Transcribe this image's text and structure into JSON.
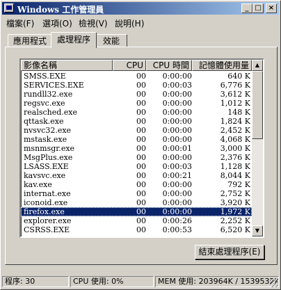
{
  "window": {
    "title": "Windows 工作管理員",
    "minimize": "_",
    "maximize": "□",
    "close": "×"
  },
  "menu": [
    "檔案(F)",
    "選項(O)",
    "檢視(V)",
    "說明(H)"
  ],
  "tabs": [
    "應用程式",
    "處理程序",
    "效能"
  ],
  "active_tab": "處理程序",
  "columns": {
    "name": "影像名稱",
    "cpu": "CPU",
    "time": "CPU 時間",
    "mem": "記憶體使用量"
  },
  "processes": [
    {
      "name": "SMSS.EXE",
      "cpu": "00",
      "time": "0:00:00",
      "mem": "640 K"
    },
    {
      "name": "SERVICES.EXE",
      "cpu": "00",
      "time": "0:00:03",
      "mem": "6,776 K"
    },
    {
      "name": "rundll32.exe",
      "cpu": "00",
      "time": "0:00:00",
      "mem": "3,612 K"
    },
    {
      "name": "regsvc.exe",
      "cpu": "00",
      "time": "0:00:00",
      "mem": "1,012 K"
    },
    {
      "name": "realsched.exe",
      "cpu": "00",
      "time": "0:00:00",
      "mem": "148 K"
    },
    {
      "name": "qttask.exe",
      "cpu": "00",
      "time": "0:00:00",
      "mem": "1,824 K"
    },
    {
      "name": "nvsvc32.exe",
      "cpu": "00",
      "time": "0:00:00",
      "mem": "2,452 K"
    },
    {
      "name": "mstask.exe",
      "cpu": "00",
      "time": "0:00:00",
      "mem": "4,068 K"
    },
    {
      "name": "msnmsgr.exe",
      "cpu": "00",
      "time": "0:00:01",
      "mem": "3,000 K"
    },
    {
      "name": "MsgPlus.exe",
      "cpu": "00",
      "time": "0:00:00",
      "mem": "2,376 K"
    },
    {
      "name": "LSASS.EXE",
      "cpu": "00",
      "time": "0:00:03",
      "mem": "1,128 K"
    },
    {
      "name": "kavsvc.exe",
      "cpu": "00",
      "time": "0:00:21",
      "mem": "8,044 K"
    },
    {
      "name": "kav.exe",
      "cpu": "00",
      "time": "0:00:00",
      "mem": "792 K"
    },
    {
      "name": "internat.exe",
      "cpu": "00",
      "time": "0:00:00",
      "mem": "2,752 K"
    },
    {
      "name": "iconoid.exe",
      "cpu": "00",
      "time": "0:00:00",
      "mem": "3,920 K"
    },
    {
      "name": "firefox.exe",
      "cpu": "00",
      "time": "0:00:00",
      "mem": "1,972 K",
      "selected": true
    },
    {
      "name": "explorer.exe",
      "cpu": "00",
      "time": "0:00:26",
      "mem": "2,252 K"
    },
    {
      "name": "CSRSS.EXE",
      "cpu": "00",
      "time": "0:00:53",
      "mem": "6,520 K"
    }
  ],
  "scroll": {
    "up": "▲",
    "down": "▼"
  },
  "end_process_button": "結束處理程序(E)",
  "status": {
    "processes": "程序: 30",
    "cpu": "CPU 使用: 0%",
    "mem": "MEM 使用: 203964K / 1539532K"
  }
}
